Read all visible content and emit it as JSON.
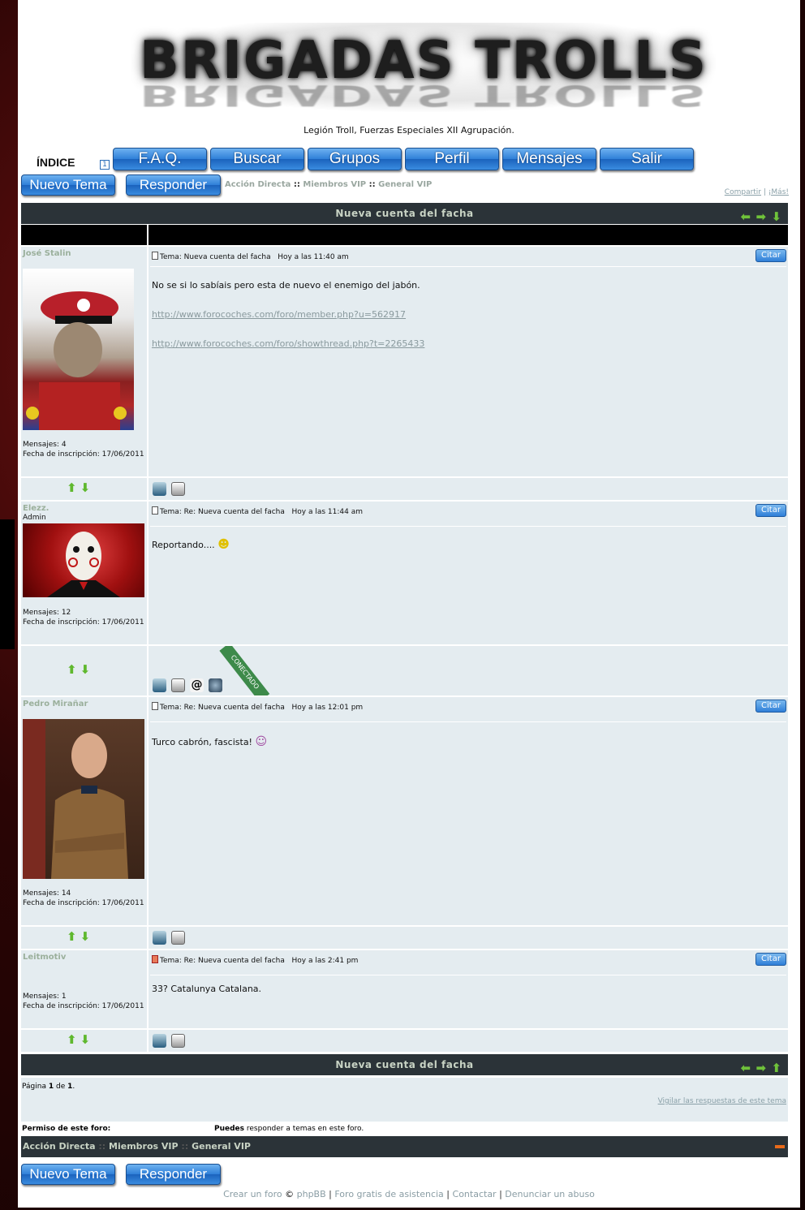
{
  "site": {
    "logo_text": "BRIGADAS TROLLS",
    "slogan": "Legión Troll, Fuerzas Especiales XII Agrupación."
  },
  "nav": {
    "index_label": "ÍNDICE",
    "page_indicator": "1",
    "items": [
      "F.A.Q.",
      "Buscar",
      "Grupos",
      "Perfil",
      "Mensajes",
      "Salir"
    ]
  },
  "actions": {
    "new_topic": "Nuevo Tema",
    "reply": "Responder"
  },
  "breadcrumb": {
    "items": [
      "Acción Directa",
      "Miembros VIP",
      "General VIP"
    ],
    "separator": "::"
  },
  "share": {
    "share_label": "Compartir",
    "more_label": "¡Más!"
  },
  "topic": {
    "title": "Nueva cuenta del facha"
  },
  "posts": [
    {
      "author": "José Stalin",
      "rank": "",
      "subject": "Tema: Nueva cuenta del facha",
      "time": "Hoy a las 11:40 am",
      "quote_label": "Citar",
      "body": "No se si lo sabíais pero esta de nuevo el enemigo del jabón.",
      "links": [
        "http://www.forocoches.com/foro/member.php?u=562917",
        "http://www.forocoches.com/foro/showthread.php?t=2265433"
      ],
      "messages": "Mensajes: 4",
      "joined": "Fecha de inscripción: 17/06/2011"
    },
    {
      "author": "Elezz.",
      "rank": "Admin",
      "subject": "Tema: Re: Nueva cuenta del facha",
      "time": "Hoy a las 11:44 am",
      "quote_label": "Citar",
      "body": "Reportando....",
      "links": [],
      "messages": "Mensajes: 12",
      "joined": "Fecha de inscripción: 17/06/2011",
      "online_label": "CONECTADO"
    },
    {
      "author": "Pedro Mirañar",
      "rank": "",
      "subject": "Tema: Re: Nueva cuenta del facha",
      "time": "Hoy a las 12:01 pm",
      "quote_label": "Citar",
      "body": "Turco cabrón, fascista!",
      "links": [],
      "messages": "Mensajes: 14",
      "joined": "Fecha de inscripción: 17/06/2011"
    },
    {
      "author": "Leitmotiv",
      "rank": "",
      "subject": "Tema: Re: Nueva cuenta del facha",
      "time": "Hoy a las 2:41 pm",
      "quote_label": "Citar",
      "body": "33? Catalunya Catalana.",
      "links": [],
      "messages": "Mensajes: 1",
      "joined": "Fecha de inscripción: 17/06/2011"
    }
  ],
  "pagination": {
    "text_prefix": "Página",
    "current": "1",
    "text_of": "de",
    "total": "1",
    "watch_label": "Vigilar las respuestas de este tema"
  },
  "permissions": {
    "label": "Permiso de este foro:",
    "can": "Puedes",
    "text": "responder a temas en este foro."
  },
  "footer": {
    "links": [
      "Crear un foro",
      "phpBB",
      "Foro gratis de asistencia",
      "Contactar",
      "Denunciar un abuso"
    ]
  },
  "colors": {
    "bar": "#2b3338",
    "post_bg": "#e4ecf0",
    "button_blue": "#2f7fd8",
    "author": "#9bb09c",
    "link": "#8a9a9e"
  }
}
